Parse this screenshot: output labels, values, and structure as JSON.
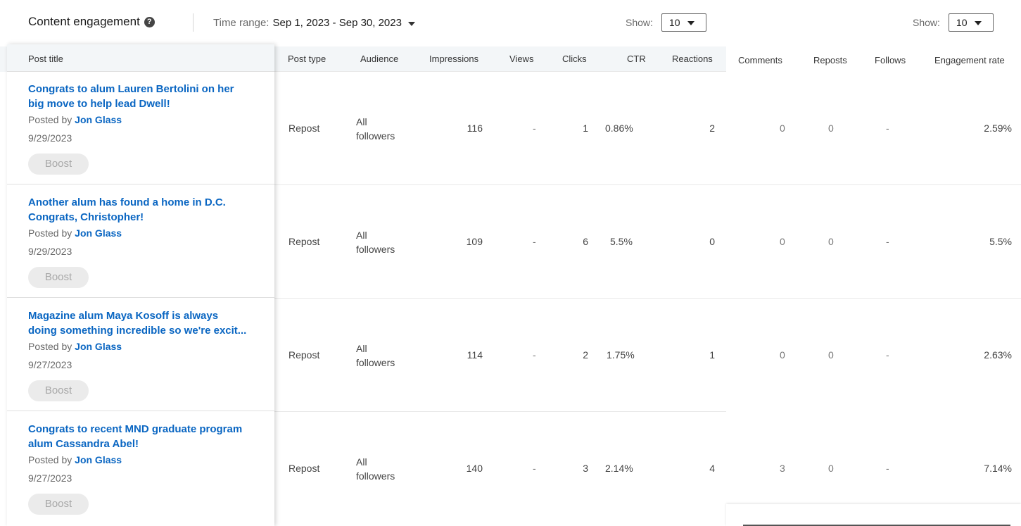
{
  "header": {
    "title": "Content engagement",
    "help_icon": "question-circle-icon",
    "time_range_label": "Time range:",
    "time_range_value": "Sep 1, 2023 - Sep 30, 2023",
    "show_label_1": "Show:",
    "show_value_1": "10",
    "show_label_2": "Show:",
    "show_value_2": "10"
  },
  "columns": {
    "post_title": "Post title",
    "post_type": "Post type",
    "audience": "Audience",
    "impressions": "Impressions",
    "views": "Views",
    "clicks": "Clicks",
    "ctr": "CTR",
    "reactions": "Reactions",
    "comments": "Comments",
    "reposts": "Reposts",
    "follows": "Follows",
    "engagement_rate": "Engagement rate"
  },
  "rows": [
    {
      "title_line1": "Congrats to alum Lauren Bertolini on her",
      "title_line2": "big move to help lead Dwell!",
      "posted_by": "Posted by",
      "author": "Jon Glass",
      "date": "9/29/2023",
      "boost": "Boost",
      "post_type": "Repost",
      "audience_line1": "All",
      "audience_line2": "followers",
      "impressions": "116",
      "views": "-",
      "clicks": "1",
      "ctr": "0.86%",
      "reactions": "2",
      "comments": "0",
      "reposts": "0",
      "follows": "-",
      "engagement_rate": "2.59%"
    },
    {
      "title_line1": "Another alum has found a home in D.C.",
      "title_line2": "Congrats, Christopher!",
      "posted_by": "Posted by",
      "author": "Jon Glass",
      "date": "9/29/2023",
      "boost": "Boost",
      "post_type": "Repost",
      "audience_line1": "All",
      "audience_line2": "followers",
      "impressions": "109",
      "views": "-",
      "clicks": "6",
      "ctr": "5.5%",
      "reactions": "0",
      "comments": "0",
      "reposts": "0",
      "follows": "-",
      "engagement_rate": "5.5%"
    },
    {
      "title_line1": "Magazine alum Maya Kosoff is always",
      "title_line2": "doing something incredible so we're excit...",
      "posted_by": "Posted by",
      "author": "Jon Glass",
      "date": "9/27/2023",
      "boost": "Boost",
      "post_type": "Repost",
      "audience_line1": "All",
      "audience_line2": "followers",
      "impressions": "114",
      "views": "-",
      "clicks": "2",
      "ctr": "1.75%",
      "reactions": "1",
      "comments": "0",
      "reposts": "0",
      "follows": "-",
      "engagement_rate": "2.63%"
    },
    {
      "title_line1": "Congrats to recent MND graduate program",
      "title_line2": "alum Cassandra Abel!",
      "posted_by": "Posted by",
      "author": "Jon Glass",
      "date": "9/27/2023",
      "boost": "Boost",
      "post_type": "Repost",
      "audience_line1": "All",
      "audience_line2": "followers",
      "impressions": "140",
      "views": "-",
      "clicks": "3",
      "ctr": "2.14%",
      "reactions": "4",
      "comments": "3",
      "reposts": "0",
      "follows": "-",
      "engagement_rate": "7.14%"
    }
  ]
}
